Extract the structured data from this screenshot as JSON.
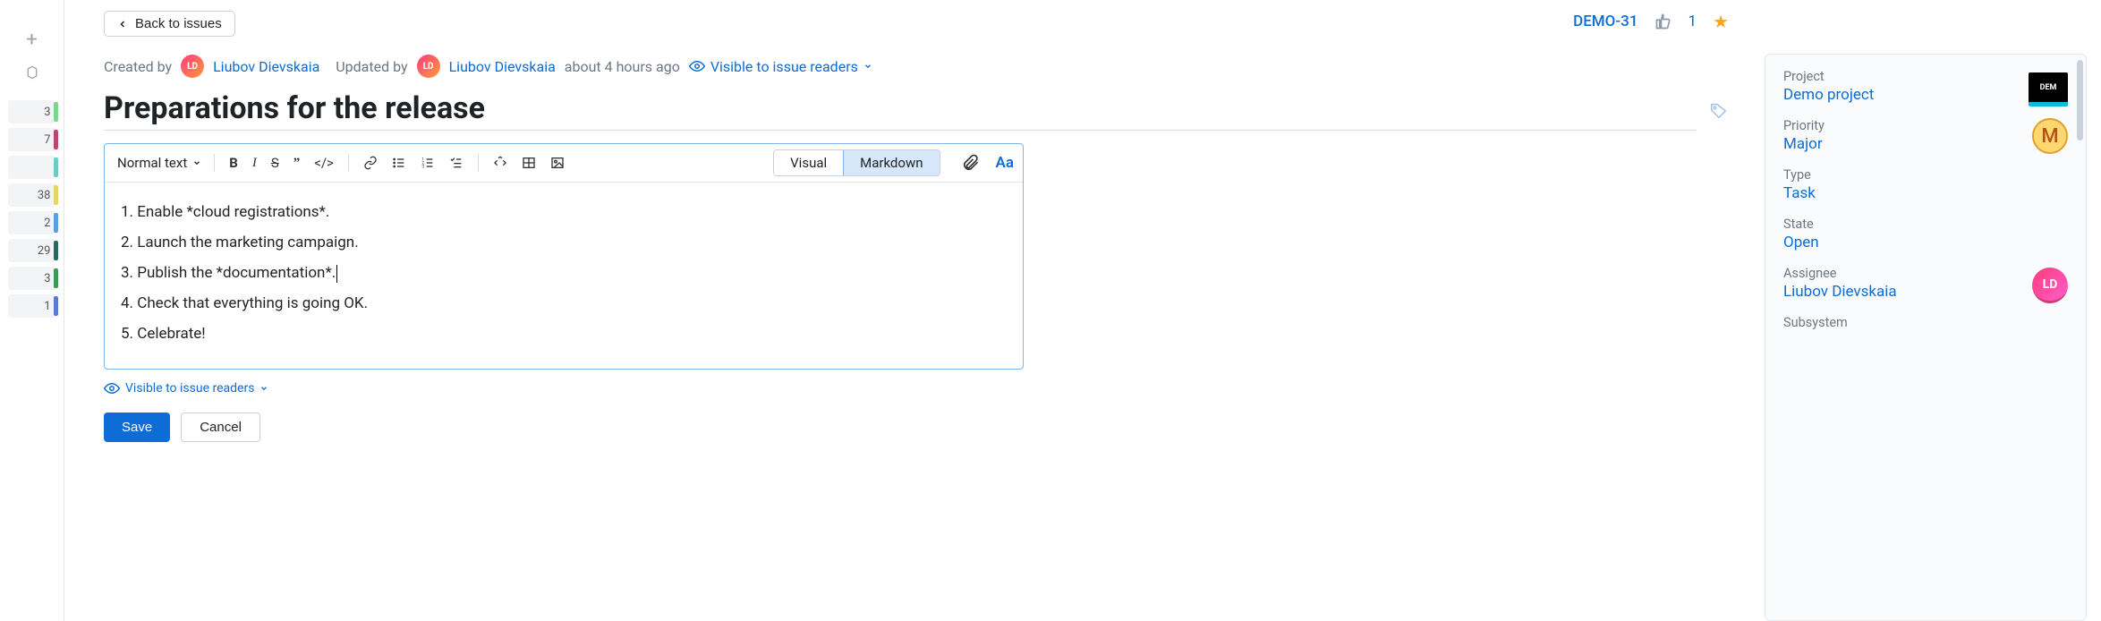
{
  "rail": {
    "items": [
      {
        "count": "3",
        "color": "#7bd68a"
      },
      {
        "count": "7",
        "color": "#b84a6f"
      },
      {
        "count": "",
        "color": "#6fc9c4"
      },
      {
        "count": "38",
        "color": "#e7d36a"
      },
      {
        "count": "2",
        "color": "#5aa0e0"
      },
      {
        "count": "29",
        "color": "#2a6a5f"
      },
      {
        "count": "3",
        "color": "#3a9a4f"
      },
      {
        "count": "1",
        "color": "#5a7ad0"
      }
    ]
  },
  "header": {
    "back": "Back to issues",
    "issue_id": "DEMO-31",
    "votes": "1"
  },
  "meta": {
    "created_label": "Created by",
    "creator": "Liubov Dievskaia",
    "creator_initials": "LD",
    "updated_label": "Updated by",
    "updater": "Liubov Dievskaia",
    "updater_initials": "LD",
    "updated_ago": "about 4 hours ago",
    "visibility": "Visible to issue readers"
  },
  "issue": {
    "title": "Preparations for the release"
  },
  "toolbar": {
    "style": "Normal text",
    "visual": "Visual",
    "markdown": "Markdown"
  },
  "editor": {
    "lines": [
      "1. Enable *cloud registrations*.",
      "2. Launch the marketing campaign.",
      "3. Publish the *documentation*.",
      "4. Check that everything is going OK.",
      "5. Celebrate!"
    ]
  },
  "below": {
    "visibility": "Visible to issue readers"
  },
  "actions": {
    "save": "Save",
    "cancel": "Cancel"
  },
  "side": {
    "project": {
      "label": "Project",
      "value": "Demo project",
      "badge": "DEM"
    },
    "priority": {
      "label": "Priority",
      "value": "Major",
      "badge": "M"
    },
    "type": {
      "label": "Type",
      "value": "Task"
    },
    "state": {
      "label": "State",
      "value": "Open"
    },
    "assignee": {
      "label": "Assignee",
      "value": "Liubov Dievskaia",
      "initials": "LD"
    },
    "subsystem": {
      "label": "Subsystem"
    }
  }
}
